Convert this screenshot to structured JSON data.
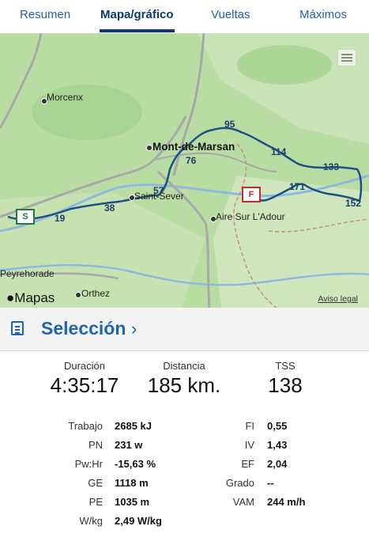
{
  "tabs": [
    {
      "label": "Resumen"
    },
    {
      "label": "Mapa/gráfico"
    },
    {
      "label": "Vueltas"
    },
    {
      "label": "Máximos"
    }
  ],
  "active_tab": "Mapa/gráfico",
  "map": {
    "places": {
      "morcenx": "Morcenx",
      "mont_de_marsan": "Mont-de-Marsan",
      "saint_sever": "Saint-Sever",
      "aire_sur_adour": "Aire Sur L'Adour",
      "peyrehorade": "Peyrehorade",
      "orthez": "Orthez"
    },
    "km_markers": [
      "19",
      "38",
      "57",
      "76",
      "95",
      "114",
      "133",
      "152",
      "171"
    ],
    "start_flag": "S",
    "finish_flag": "F",
    "maps_brand": "Mapas",
    "legal_link": "Aviso legal",
    "route_color": "#1d4f87"
  },
  "selection": {
    "title": "Selección",
    "chevron": "›"
  },
  "summary": {
    "duration_label": "Duración",
    "duration_value": "4:35:17",
    "distance_label": "Distancia",
    "distance_value": "185 km.",
    "tss_label": "TSS",
    "tss_value": "138"
  },
  "metrics_left": [
    {
      "label": "Trabajo",
      "value": "2685 kJ"
    },
    {
      "label": "PN",
      "value": "231 w"
    },
    {
      "label": "Pw:Hr",
      "value": "-15,63 %"
    },
    {
      "label": "GE",
      "value": "1118 m"
    },
    {
      "label": "PE",
      "value": "1035 m"
    },
    {
      "label": "W/kg",
      "value": "2,49 W/kg"
    }
  ],
  "metrics_right": [
    {
      "label": "FI",
      "value": "0,55"
    },
    {
      "label": "IV",
      "value": "1,43"
    },
    {
      "label": "EF",
      "value": "2,04"
    },
    {
      "label": "Grado",
      "value": "--"
    },
    {
      "label": "VAM",
      "value": "244 m/h"
    }
  ],
  "colors": {
    "accent": "#1f64b0",
    "active_tab": "#0b3a6e",
    "start": "#1f7d3a",
    "finish": "#c52b2b"
  }
}
